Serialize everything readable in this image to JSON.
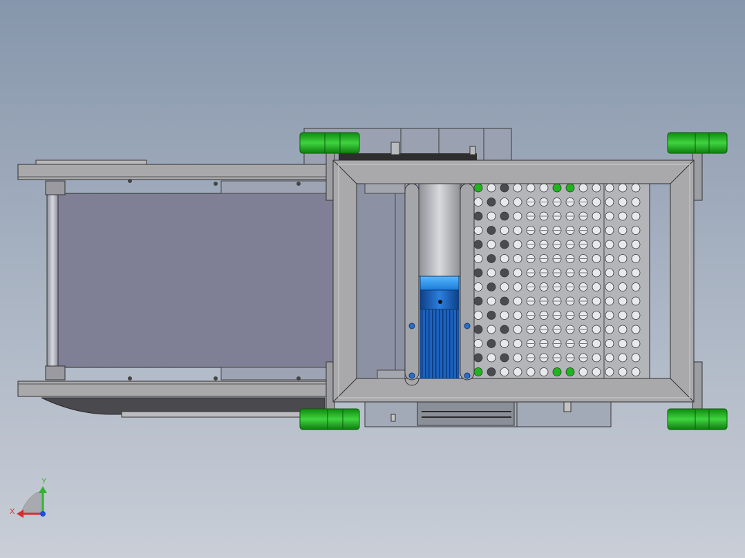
{
  "viewport": {
    "background_top": "#8696ab",
    "background_bottom": "#c9ced7"
  },
  "model": {
    "frame_color": "#a9a9ab",
    "wheel_color": "#1fb51f",
    "motor_color": "#1a5fb4",
    "belt_color": "#7f8095",
    "perforated_plate_color": "#b4b5b8"
  },
  "triad": {
    "x_label": "X",
    "y_label": "Y",
    "x_color": "#d32f2f",
    "y_color": "#2fb52f",
    "z_color": "#1e4fd8"
  }
}
